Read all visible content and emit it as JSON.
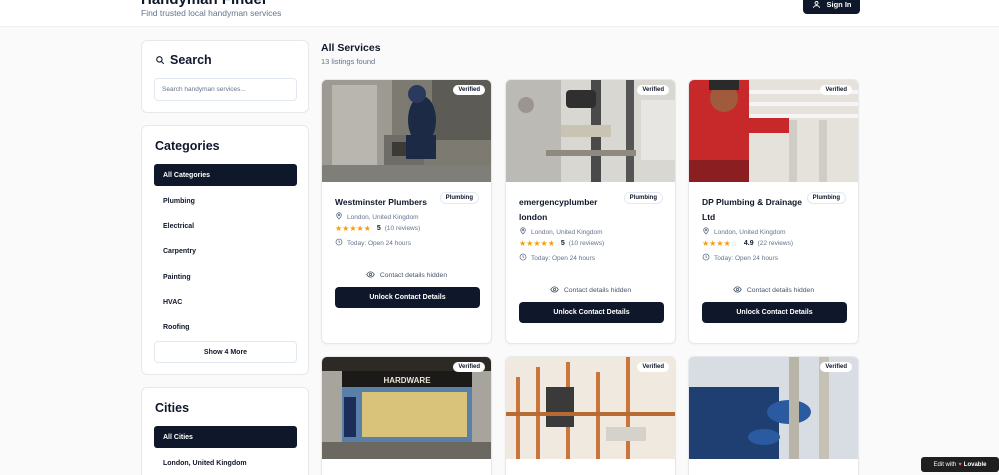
{
  "header": {
    "title": "Handyman Finder",
    "subtitle": "Find trusted local handyman services",
    "signin_label": "Sign In"
  },
  "search": {
    "title": "Search",
    "placeholder": "Search handyman services..."
  },
  "categories": {
    "title": "Categories",
    "items": [
      "All Categories",
      "Plumbing",
      "Electrical",
      "Carpentry",
      "Painting",
      "HVAC",
      "Roofing"
    ],
    "show_more": "Show 4 More"
  },
  "cities": {
    "title": "Cities",
    "items": [
      "All Cities",
      "London, United Kingdom"
    ]
  },
  "main": {
    "title": "All Services",
    "count": "13 listings found"
  },
  "listings": [
    {
      "name": "Westminster Plumbers",
      "category": "Plumbing",
      "location": "London, United Kingdom",
      "rating": "5",
      "stars": 5,
      "reviews": "(10 reviews)",
      "hours": "Today: Open 24 hours",
      "verified": "Verified",
      "contact_hidden": "Contact details hidden",
      "unlock": "Unlock Contact Details"
    },
    {
      "name": "emergencyplumber london",
      "category": "Plumbing",
      "location": "London, United Kingdom",
      "rating": "5",
      "stars": 5,
      "reviews": "(10 reviews)",
      "hours": "Today: Open 24 hours",
      "verified": "Verified",
      "contact_hidden": "Contact details hidden",
      "unlock": "Unlock Contact Details"
    },
    {
      "name": "DP Plumbing & Drainage Ltd",
      "category": "Plumbing",
      "location": "London, United Kingdom",
      "rating": "4.9",
      "stars": 4.9,
      "reviews": "(22 reviews)",
      "hours": "Today: Open 24 hours",
      "verified": "Verified",
      "contact_hidden": "Contact details hidden",
      "unlock": "Unlock Contact Details"
    },
    {
      "verified": "Verified"
    },
    {
      "verified": "Verified"
    },
    {
      "verified": "Verified"
    }
  ],
  "colors": {
    "primary": "#0f172a",
    "star": "#f59e0b",
    "muted": "#64748b"
  },
  "footer_badge": {
    "prefix": "Edit with",
    "brand": "Lovable"
  }
}
